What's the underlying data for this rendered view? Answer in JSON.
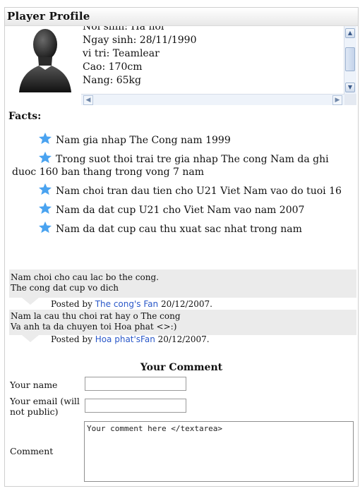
{
  "header": {
    "title": "Player Profile"
  },
  "profile": {
    "lines": [
      "Noi sinh: Ha noi",
      "Ngay sinh: 28/11/1990",
      "vi tri: Teamlear",
      "Cao: 170cm",
      "Nang: 65kg"
    ]
  },
  "facts": {
    "heading": "Facts:",
    "items": [
      "Nam gia nhap The Cong nam 1999",
      "Trong suot thoi trai tre gia nhap The cong Nam da ghi duoc 160 ban thang trong vong 7 nam",
      "Nam choi tran dau tien cho U21 Viet Nam vao do tuoi 16",
      "Nam da dat cup U21 cho Viet Nam vao nam 2007",
      "Nam da dat cup cau thu xuat sac nhat trong nam"
    ]
  },
  "comments": [
    {
      "line1": "Nam choi cho cau lac bo the cong.",
      "line2": "The cong dat cup vo dich",
      "posted_by": "Posted by",
      "author": "The cong's Fan",
      "date": "20/12/2007."
    },
    {
      "line1": "Nam la cau thu choi rat hay o The cong",
      "line2": "Va anh ta da chuyen toi Hoa phat <>:)",
      "posted_by": "Posted by",
      "author": "Hoa phat'sFan",
      "date": "20/12/2007."
    }
  ],
  "form": {
    "title": "Your Comment",
    "name_label": "Your name",
    "email_label": "Your email (will not public)",
    "comment_label": "Comment",
    "name_value": "",
    "email_value": "",
    "comment_value": "Your comment here </textarea>"
  },
  "colors": {
    "link": "#2a58c9",
    "comment_bg": "#ebebeb",
    "star": "#4aa3f0"
  }
}
